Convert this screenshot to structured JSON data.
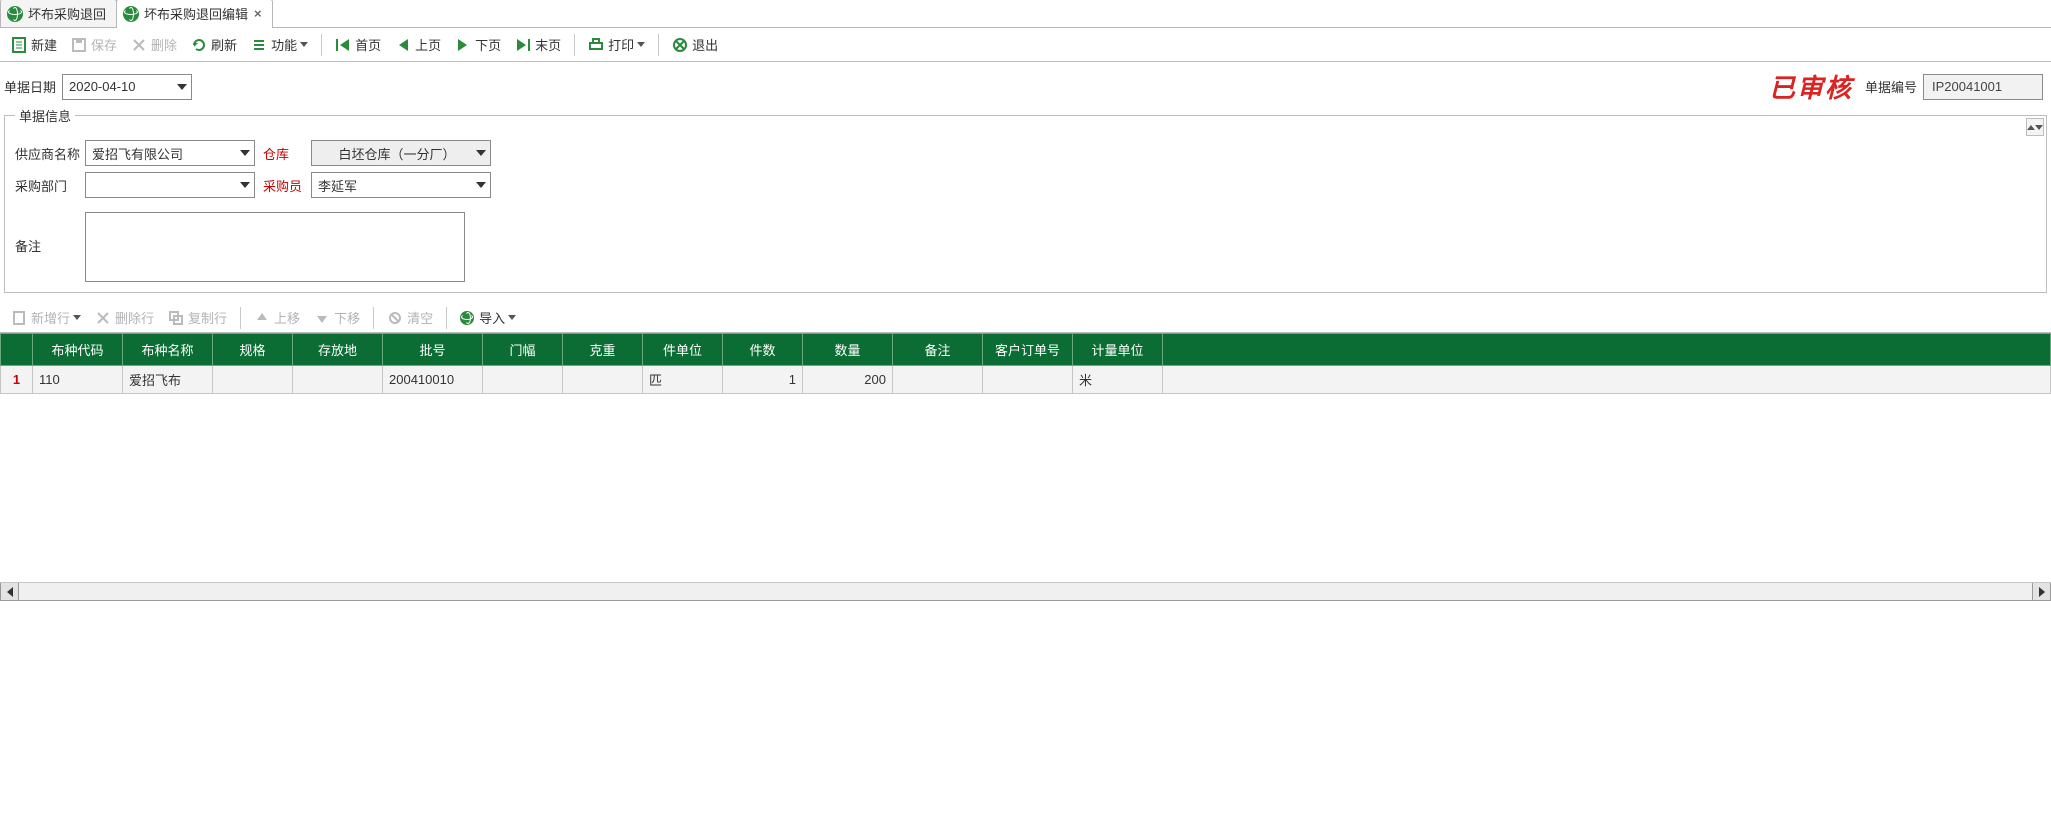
{
  "tabs": [
    {
      "label": "坏布采购退回",
      "active": false,
      "closable": false
    },
    {
      "label": "坏布采购退回编辑",
      "active": true,
      "closable": true
    }
  ],
  "toolbar": {
    "new": "新建",
    "save": "保存",
    "delete": "删除",
    "refresh": "刷新",
    "functions": "功能",
    "first": "首页",
    "prev": "上页",
    "next": "下页",
    "last": "末页",
    "print": "打印",
    "exit": "退出"
  },
  "header": {
    "date_label": "单据日期",
    "date_value": "2020-04-10",
    "stamp": "已审核",
    "docno_label": "单据编号",
    "docno_value": "IP20041001"
  },
  "form": {
    "legend": "单据信息",
    "supplier_label": "供应商名称",
    "supplier_value": "爱招飞有限公司",
    "warehouse_label": "仓库",
    "warehouse_value": "白坯仓库（一分厂）",
    "dept_label": "采购部门",
    "dept_value": "",
    "buyer_label": "采购员",
    "buyer_value": "李延军",
    "remark_label": "备注",
    "remark_value": ""
  },
  "toolbar2": {
    "addrow": "新增行",
    "delrow": "删除行",
    "copyrow": "复制行",
    "moveup": "上移",
    "movedown": "下移",
    "clear": "清空",
    "import": "导入"
  },
  "table": {
    "columns": [
      "布种代码",
      "布种名称",
      "规格",
      "存放地",
      "批号",
      "门幅",
      "克重",
      "件单位",
      "件数",
      "数量",
      "备注",
      "客户订单号",
      "计量单位"
    ],
    "rows": [
      {
        "no": "1",
        "code": "110",
        "name": "爱招飞布",
        "spec": "",
        "loc": "",
        "batch": "200410010",
        "width": "",
        "gram": "",
        "pieceUnit": "匹",
        "pieces": "1",
        "qty": "200",
        "remark": "",
        "orderNo": "",
        "unit": "米"
      }
    ]
  }
}
